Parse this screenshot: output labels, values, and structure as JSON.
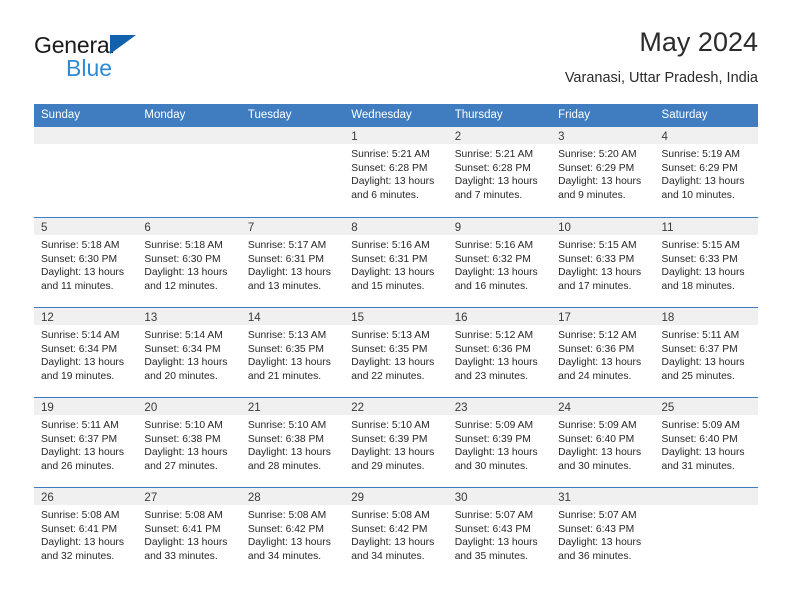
{
  "brand": {
    "name_top": "General",
    "name_bottom": "Blue",
    "triangle_color": "#1161ad",
    "bottom_color": "#2e8bd4"
  },
  "header": {
    "title": "May 2024",
    "subtitle": "Varanasi, Uttar Pradesh, India"
  },
  "theme": {
    "header_blue": "#3f7dc0",
    "day_band_gray": "#f0f0f0",
    "text_color": "#272727"
  },
  "calendar": {
    "weekdays": [
      "Sunday",
      "Monday",
      "Tuesday",
      "Wednesday",
      "Thursday",
      "Friday",
      "Saturday"
    ],
    "weeks": [
      [
        {
          "day": "",
          "empty": true
        },
        {
          "day": "",
          "empty": true
        },
        {
          "day": "",
          "empty": true
        },
        {
          "day": "1",
          "sunrise": "Sunrise: 5:21 AM",
          "sunset": "Sunset: 6:28 PM",
          "daylight": "Daylight: 13 hours and 6 minutes."
        },
        {
          "day": "2",
          "sunrise": "Sunrise: 5:21 AM",
          "sunset": "Sunset: 6:28 PM",
          "daylight": "Daylight: 13 hours and 7 minutes."
        },
        {
          "day": "3",
          "sunrise": "Sunrise: 5:20 AM",
          "sunset": "Sunset: 6:29 PM",
          "daylight": "Daylight: 13 hours and 9 minutes."
        },
        {
          "day": "4",
          "sunrise": "Sunrise: 5:19 AM",
          "sunset": "Sunset: 6:29 PM",
          "daylight": "Daylight: 13 hours and 10 minutes."
        }
      ],
      [
        {
          "day": "5",
          "sunrise": "Sunrise: 5:18 AM",
          "sunset": "Sunset: 6:30 PM",
          "daylight": "Daylight: 13 hours and 11 minutes."
        },
        {
          "day": "6",
          "sunrise": "Sunrise: 5:18 AM",
          "sunset": "Sunset: 6:30 PM",
          "daylight": "Daylight: 13 hours and 12 minutes."
        },
        {
          "day": "7",
          "sunrise": "Sunrise: 5:17 AM",
          "sunset": "Sunset: 6:31 PM",
          "daylight": "Daylight: 13 hours and 13 minutes."
        },
        {
          "day": "8",
          "sunrise": "Sunrise: 5:16 AM",
          "sunset": "Sunset: 6:31 PM",
          "daylight": "Daylight: 13 hours and 15 minutes."
        },
        {
          "day": "9",
          "sunrise": "Sunrise: 5:16 AM",
          "sunset": "Sunset: 6:32 PM",
          "daylight": "Daylight: 13 hours and 16 minutes."
        },
        {
          "day": "10",
          "sunrise": "Sunrise: 5:15 AM",
          "sunset": "Sunset: 6:33 PM",
          "daylight": "Daylight: 13 hours and 17 minutes."
        },
        {
          "day": "11",
          "sunrise": "Sunrise: 5:15 AM",
          "sunset": "Sunset: 6:33 PM",
          "daylight": "Daylight: 13 hours and 18 minutes."
        }
      ],
      [
        {
          "day": "12",
          "sunrise": "Sunrise: 5:14 AM",
          "sunset": "Sunset: 6:34 PM",
          "daylight": "Daylight: 13 hours and 19 minutes."
        },
        {
          "day": "13",
          "sunrise": "Sunrise: 5:14 AM",
          "sunset": "Sunset: 6:34 PM",
          "daylight": "Daylight: 13 hours and 20 minutes."
        },
        {
          "day": "14",
          "sunrise": "Sunrise: 5:13 AM",
          "sunset": "Sunset: 6:35 PM",
          "daylight": "Daylight: 13 hours and 21 minutes."
        },
        {
          "day": "15",
          "sunrise": "Sunrise: 5:13 AM",
          "sunset": "Sunset: 6:35 PM",
          "daylight": "Daylight: 13 hours and 22 minutes."
        },
        {
          "day": "16",
          "sunrise": "Sunrise: 5:12 AM",
          "sunset": "Sunset: 6:36 PM",
          "daylight": "Daylight: 13 hours and 23 minutes."
        },
        {
          "day": "17",
          "sunrise": "Sunrise: 5:12 AM",
          "sunset": "Sunset: 6:36 PM",
          "daylight": "Daylight: 13 hours and 24 minutes."
        },
        {
          "day": "18",
          "sunrise": "Sunrise: 5:11 AM",
          "sunset": "Sunset: 6:37 PM",
          "daylight": "Daylight: 13 hours and 25 minutes."
        }
      ],
      [
        {
          "day": "19",
          "sunrise": "Sunrise: 5:11 AM",
          "sunset": "Sunset: 6:37 PM",
          "daylight": "Daylight: 13 hours and 26 minutes."
        },
        {
          "day": "20",
          "sunrise": "Sunrise: 5:10 AM",
          "sunset": "Sunset: 6:38 PM",
          "daylight": "Daylight: 13 hours and 27 minutes."
        },
        {
          "day": "21",
          "sunrise": "Sunrise: 5:10 AM",
          "sunset": "Sunset: 6:38 PM",
          "daylight": "Daylight: 13 hours and 28 minutes."
        },
        {
          "day": "22",
          "sunrise": "Sunrise: 5:10 AM",
          "sunset": "Sunset: 6:39 PM",
          "daylight": "Daylight: 13 hours and 29 minutes."
        },
        {
          "day": "23",
          "sunrise": "Sunrise: 5:09 AM",
          "sunset": "Sunset: 6:39 PM",
          "daylight": "Daylight: 13 hours and 30 minutes."
        },
        {
          "day": "24",
          "sunrise": "Sunrise: 5:09 AM",
          "sunset": "Sunset: 6:40 PM",
          "daylight": "Daylight: 13 hours and 30 minutes."
        },
        {
          "day": "25",
          "sunrise": "Sunrise: 5:09 AM",
          "sunset": "Sunset: 6:40 PM",
          "daylight": "Daylight: 13 hours and 31 minutes."
        }
      ],
      [
        {
          "day": "26",
          "sunrise": "Sunrise: 5:08 AM",
          "sunset": "Sunset: 6:41 PM",
          "daylight": "Daylight: 13 hours and 32 minutes."
        },
        {
          "day": "27",
          "sunrise": "Sunrise: 5:08 AM",
          "sunset": "Sunset: 6:41 PM",
          "daylight": "Daylight: 13 hours and 33 minutes."
        },
        {
          "day": "28",
          "sunrise": "Sunrise: 5:08 AM",
          "sunset": "Sunset: 6:42 PM",
          "daylight": "Daylight: 13 hours and 34 minutes."
        },
        {
          "day": "29",
          "sunrise": "Sunrise: 5:08 AM",
          "sunset": "Sunset: 6:42 PM",
          "daylight": "Daylight: 13 hours and 34 minutes."
        },
        {
          "day": "30",
          "sunrise": "Sunrise: 5:07 AM",
          "sunset": "Sunset: 6:43 PM",
          "daylight": "Daylight: 13 hours and 35 minutes."
        },
        {
          "day": "31",
          "sunrise": "Sunrise: 5:07 AM",
          "sunset": "Sunset: 6:43 PM",
          "daylight": "Daylight: 13 hours and 36 minutes."
        },
        {
          "day": "",
          "empty": true
        }
      ]
    ]
  }
}
